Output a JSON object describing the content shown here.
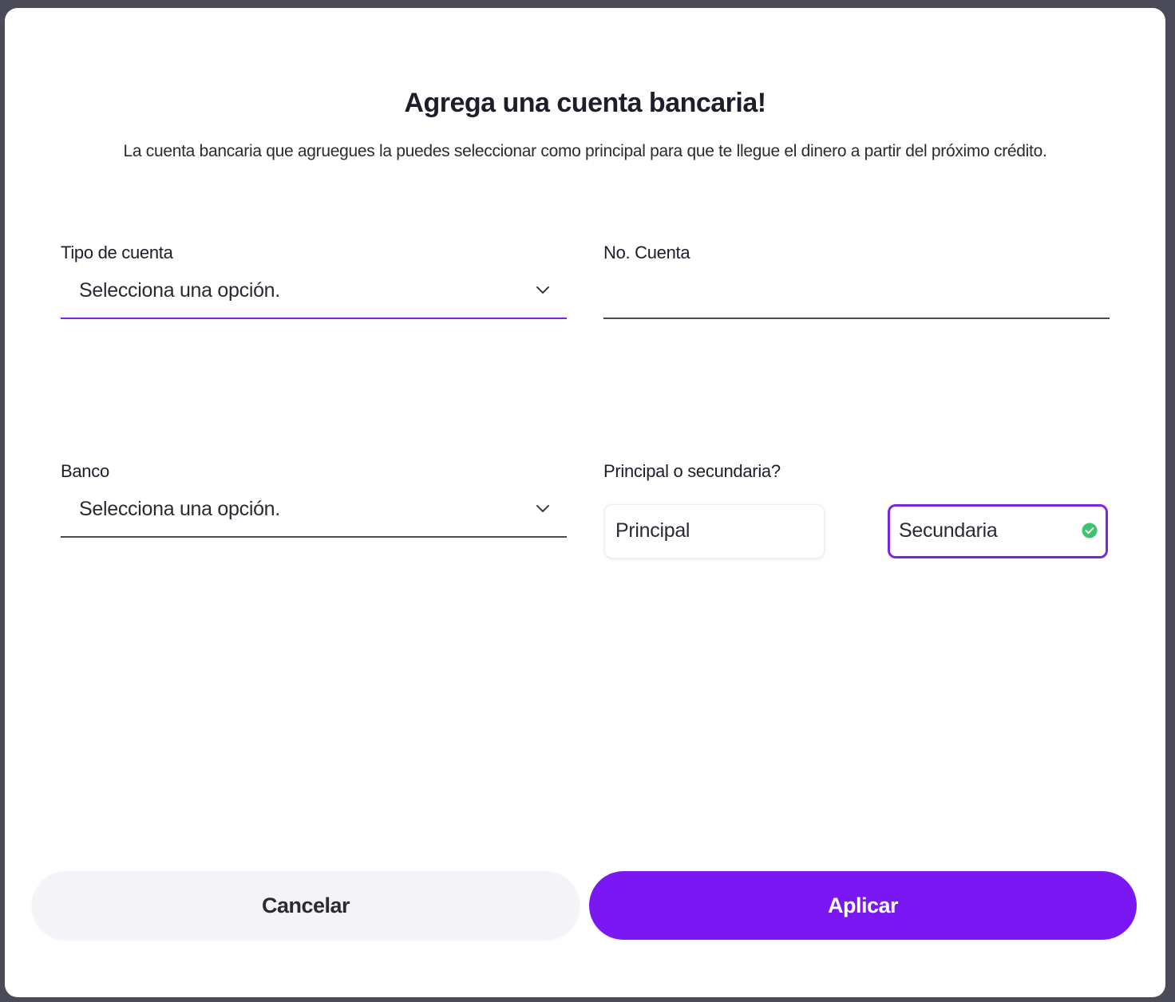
{
  "dialog": {
    "title": "Agrega una cuenta bancaria!",
    "subtitle": "La cuenta bancaria que agruegues la puedes seleccionar como principal para que te llegue el dinero a partir del próximo crédito."
  },
  "form": {
    "account_type": {
      "label": "Tipo de cuenta",
      "value": "Selecciona una opción."
    },
    "account_number": {
      "label": "No. Cuenta",
      "value": ""
    },
    "bank": {
      "label": "Banco",
      "value": "Selecciona una opción."
    },
    "priority": {
      "label": "Principal o secundaria?",
      "options": [
        {
          "label": "Principal",
          "selected": false
        },
        {
          "label": "Secundaria",
          "selected": true
        }
      ]
    }
  },
  "actions": {
    "cancel_label": "Cancelar",
    "apply_label": "Aplicar"
  },
  "colors": {
    "accent": "#7a17f2",
    "selected_border": "#7a25e8",
    "check_green": "#3ec46d",
    "cancel_bg": "#f4f3f8"
  },
  "icons": {
    "dropdown": "chevron-down-icon",
    "selected_option": "check-circle-icon"
  }
}
